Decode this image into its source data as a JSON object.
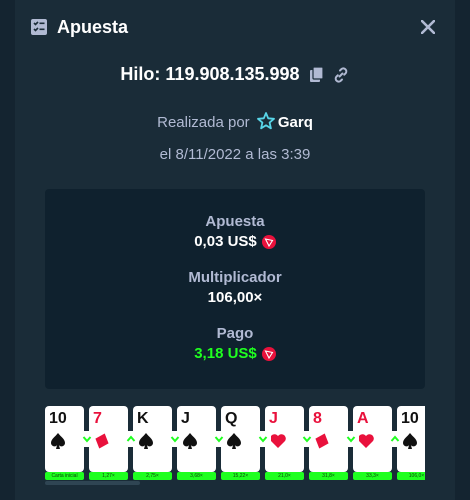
{
  "header": {
    "title": "Apuesta"
  },
  "game": {
    "id_label": "Hilo: 119.908.135.998"
  },
  "placed": {
    "prefix": "Realizada por",
    "username": "Garq"
  },
  "date": "el 8/11/2022 a las 3:39",
  "stats": {
    "bet_label": "Apuesta",
    "bet_value": "0,03 US$",
    "multiplier_label": "Multiplicador",
    "multiplier_value": "106,00×",
    "payout_label": "Pago",
    "payout_value": "3,18 US$"
  },
  "cards": [
    {
      "rank": "10",
      "suit": "spade",
      "color": "black",
      "mult": "Carta inicial"
    },
    {
      "rank": "7",
      "suit": "diamond",
      "color": "red",
      "mult": "1,27×"
    },
    {
      "rank": "K",
      "suit": "spade",
      "color": "black",
      "mult": "2,75×"
    },
    {
      "rank": "J",
      "suit": "spade",
      "color": "black",
      "mult": "3,68×"
    },
    {
      "rank": "Q",
      "suit": "spade",
      "color": "black",
      "mult": "15,22×"
    },
    {
      "rank": "J",
      "suit": "heart",
      "color": "red",
      "mult": "21,0×"
    },
    {
      "rank": "8",
      "suit": "diamond",
      "color": "red",
      "mult": "31,8×"
    },
    {
      "rank": "A",
      "suit": "heart",
      "color": "red",
      "mult": "33,3×"
    },
    {
      "rank": "10",
      "suit": "spade",
      "color": "black",
      "mult": "106,0×"
    }
  ],
  "guesses": [
    "lower",
    "higher",
    "lower",
    "lower",
    "lower",
    "lower",
    "lower",
    "higher"
  ],
  "colors": {
    "accent_green": "#1fff20",
    "bg": "#1a2c38",
    "panel": "#0f212e",
    "muted": "#b1bad3",
    "red": "#e9113c"
  },
  "icons": [
    "bet-slip-icon",
    "close-icon",
    "copy-icon",
    "link-icon",
    "vip-star-icon",
    "trx-coin-icon",
    "spade-icon",
    "diamond-icon",
    "heart-icon",
    "chevron-down-icon",
    "chevron-up-icon"
  ]
}
